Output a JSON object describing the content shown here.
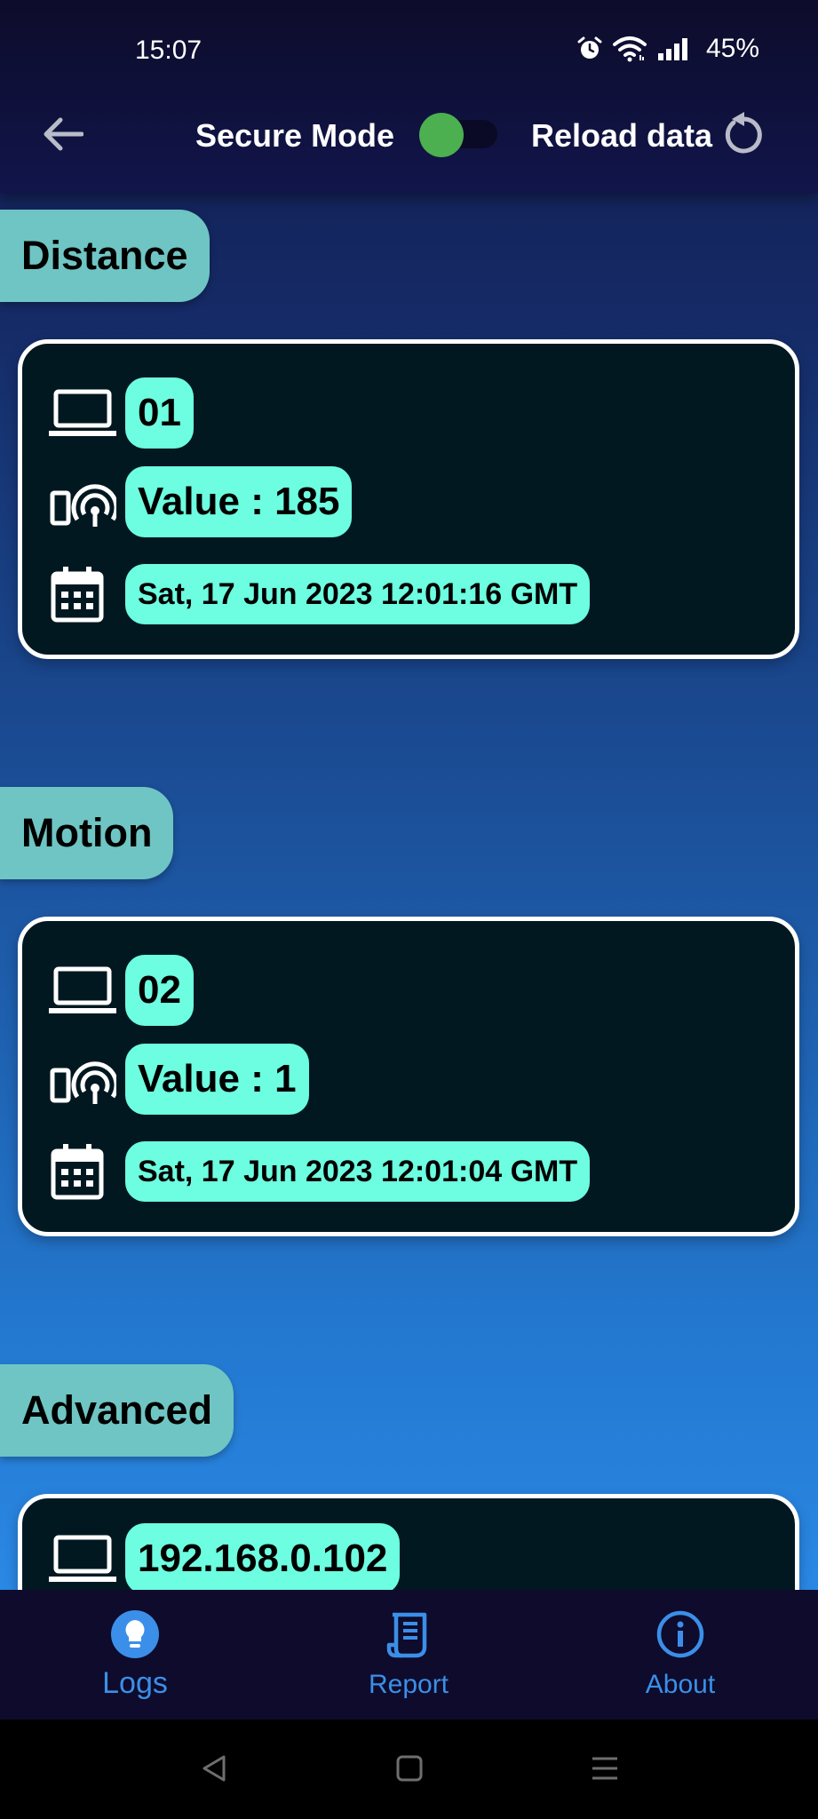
{
  "status_bar": {
    "time": "15:07",
    "battery": "45%",
    "icons": [
      "alarm-icon",
      "wifi-icon",
      "signal-icon"
    ]
  },
  "app_bar": {
    "back_icon": "arrow-left-icon",
    "secure_mode_label": "Secure Mode",
    "secure_mode_on": true,
    "reload_label": "Reload data",
    "reload_icon": "refresh-icon"
  },
  "sections": [
    {
      "title": "Distance",
      "device_id": "01",
      "value": "Value : 185",
      "timestamp": "Sat, 17 Jun 2023 12:01:16 GMT"
    },
    {
      "title": "Motion",
      "device_id": "02",
      "value": "Value : 1",
      "timestamp": "Sat, 17 Jun 2023 12:01:04 GMT"
    },
    {
      "title": "Advanced",
      "device_id": "192.168.0.102"
    }
  ],
  "bottom_nav": {
    "items": [
      {
        "label": "Logs",
        "icon": "lightbulb-icon",
        "active": true
      },
      {
        "label": "Report",
        "icon": "receipt-icon",
        "active": false
      },
      {
        "label": "About",
        "icon": "info-icon",
        "active": false
      }
    ]
  },
  "colors": {
    "chip": "#6fc5c3",
    "pill": "#6dfde0",
    "card": "#011820",
    "nav_accent": "#3b8fe8",
    "toggle_on": "#4caf50"
  }
}
